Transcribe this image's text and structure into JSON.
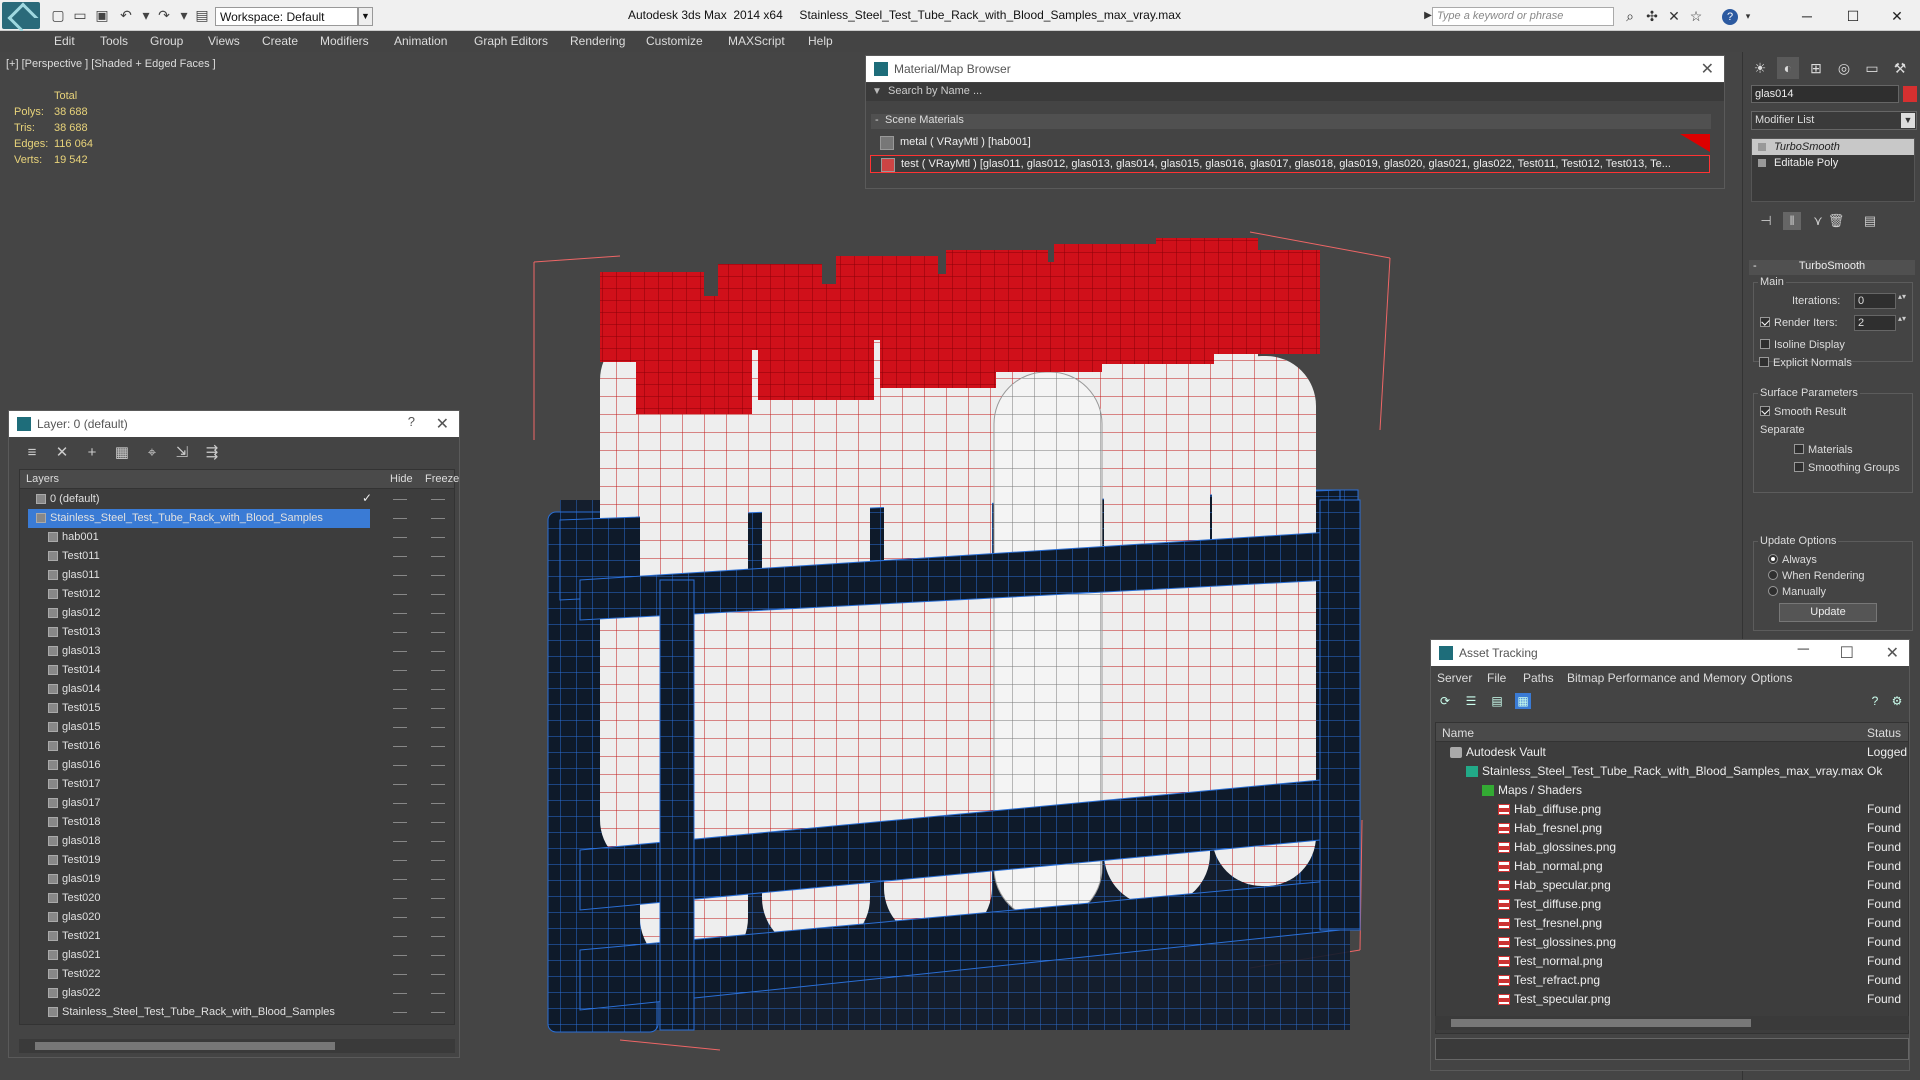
{
  "titlebar": {
    "workspace": "Workspace: Default",
    "app_title": "Autodesk 3ds Max  2014 x64     Stainless_Steel_Test_Tube_Rack_with_Blood_Samples_max_vray.max",
    "search_placeholder": "Type a keyword or phrase"
  },
  "menu": [
    "Edit",
    "Tools",
    "Group",
    "Views",
    "Create",
    "Modifiers",
    "Animation",
    "Graph Editors",
    "Rendering",
    "Customize",
    "MAXScript",
    "Help"
  ],
  "viewport": {
    "label": "[+] [Perspective ] [Shaded + Edged Faces ]",
    "stats": {
      "total": "Total",
      "polys_label": "Polys:",
      "polys": "38 688",
      "tris_label": "Tris:",
      "tris": "38 688",
      "edges_label": "Edges:",
      "edges": "116 064",
      "verts_label": "Verts:",
      "verts": "19 542"
    }
  },
  "material_browser": {
    "title": "Material/Map Browser",
    "search": "Search by Name ...",
    "section": "Scene Materials",
    "materials": [
      "metal  ( VRayMtl ) [hab001]",
      "test  ( VRayMtl ) [glas011, glas012, glas013, glas014, glas015, glas016, glas017, glas018, glas019, glas020, glas021, glas022, Test011, Test012, Test013, Te..."
    ]
  },
  "layer_panel": {
    "title": "Layer: 0 (default)",
    "help": "?",
    "col_layers": "Layers",
    "col_hide": "Hide",
    "col_freeze": "Freeze",
    "rows": [
      {
        "name": "0 (default)",
        "indent": 0
      },
      {
        "name": "Stainless_Steel_Test_Tube_Rack_with_Blood_Samples",
        "indent": 0
      },
      {
        "name": "hab001",
        "indent": 1
      },
      {
        "name": "Test011",
        "indent": 1
      },
      {
        "name": "glas011",
        "indent": 1
      },
      {
        "name": "Test012",
        "indent": 1
      },
      {
        "name": "glas012",
        "indent": 1
      },
      {
        "name": "Test013",
        "indent": 1
      },
      {
        "name": "glas013",
        "indent": 1
      },
      {
        "name": "Test014",
        "indent": 1
      },
      {
        "name": "glas014",
        "indent": 1
      },
      {
        "name": "Test015",
        "indent": 1
      },
      {
        "name": "glas015",
        "indent": 1
      },
      {
        "name": "Test016",
        "indent": 1
      },
      {
        "name": "glas016",
        "indent": 1
      },
      {
        "name": "Test017",
        "indent": 1
      },
      {
        "name": "glas017",
        "indent": 1
      },
      {
        "name": "Test018",
        "indent": 1
      },
      {
        "name": "glas018",
        "indent": 1
      },
      {
        "name": "Test019",
        "indent": 1
      },
      {
        "name": "glas019",
        "indent": 1
      },
      {
        "name": "Test020",
        "indent": 1
      },
      {
        "name": "glas020",
        "indent": 1
      },
      {
        "name": "Test021",
        "indent": 1
      },
      {
        "name": "glas021",
        "indent": 1
      },
      {
        "name": "Test022",
        "indent": 1
      },
      {
        "name": "glas022",
        "indent": 1
      },
      {
        "name": "Stainless_Steel_Test_Tube_Rack_with_Blood_Samples",
        "indent": 1
      }
    ]
  },
  "command_panel": {
    "object_name": "glas014",
    "object_color": "#d63030",
    "modifier_list": "Modifier List",
    "stack": [
      "TurboSmooth",
      "Editable Poly"
    ],
    "rollout_title": "TurboSmooth",
    "main_group": "Main",
    "iterations_label": "Iterations:",
    "iterations": "0",
    "render_iters_label": "Render Iters:",
    "render_iters": "2",
    "isoline": "Isoline Display",
    "explicit_normals": "Explicit Normals",
    "surface_group": "Surface Parameters",
    "smooth_result": "Smooth Result",
    "separate": "Separate",
    "materials": "Materials",
    "smoothing_groups": "Smoothing Groups",
    "update_group": "Update Options",
    "always": "Always",
    "when_rendering": "When Rendering",
    "manually": "Manually",
    "update_btn": "Update"
  },
  "asset_tracking": {
    "title": "Asset Tracking",
    "menu": [
      "Server",
      "File",
      "Paths",
      "Bitmap Performance and Memory",
      "Options"
    ],
    "col_name": "Name",
    "col_status": "Status",
    "rows": [
      {
        "name": "Autodesk Vault",
        "status": "Logged",
        "indent": 0,
        "icon": "vault"
      },
      {
        "name": "Stainless_Steel_Test_Tube_Rack_with_Blood_Samples_max_vray.max",
        "status": "Ok",
        "indent": 1,
        "icon": "max"
      },
      {
        "name": "Maps / Shaders",
        "status": "",
        "indent": 2,
        "icon": "folder"
      },
      {
        "name": "Hab_diffuse.png",
        "status": "Found",
        "indent": 3,
        "icon": "png"
      },
      {
        "name": "Hab_fresnel.png",
        "status": "Found",
        "indent": 3,
        "icon": "png"
      },
      {
        "name": "Hab_glossines.png",
        "status": "Found",
        "indent": 3,
        "icon": "png"
      },
      {
        "name": "Hab_normal.png",
        "status": "Found",
        "indent": 3,
        "icon": "png"
      },
      {
        "name": "Hab_specular.png",
        "status": "Found",
        "indent": 3,
        "icon": "png"
      },
      {
        "name": "Test_diffuse.png",
        "status": "Found",
        "indent": 3,
        "icon": "png"
      },
      {
        "name": "Test_fresnel.png",
        "status": "Found",
        "indent": 3,
        "icon": "png"
      },
      {
        "name": "Test_glossines.png",
        "status": "Found",
        "indent": 3,
        "icon": "png"
      },
      {
        "name": "Test_normal.png",
        "status": "Found",
        "indent": 3,
        "icon": "png"
      },
      {
        "name": "Test_refract.png",
        "status": "Found",
        "indent": 3,
        "icon": "png"
      },
      {
        "name": "Test_specular.png",
        "status": "Found",
        "indent": 3,
        "icon": "png"
      }
    ]
  },
  "colors": {
    "selection": "#3a7bd5",
    "cap_red": "#d0101a",
    "rack_wire": "#2a6fd6",
    "stats_yellow": "#e8d37a"
  }
}
